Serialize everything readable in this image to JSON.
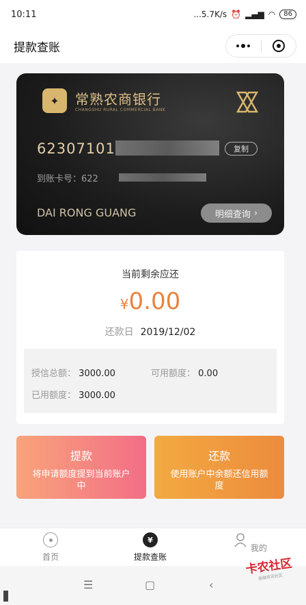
{
  "status_bar": {
    "time": "10:11",
    "net_speed": "...5.7K/s",
    "battery": "86"
  },
  "nav": {
    "title": "提款查账"
  },
  "card": {
    "bank_name": "常熟农商银行",
    "bank_subtitle": "CHANGSHU RURAL COMMERCIAL BANK",
    "card_number_visible": "62307101",
    "copy_label": "复制",
    "receive_label": "到账卡号：622",
    "holder_name": "DAI RONG GUANG",
    "detail_label": "明细查询"
  },
  "balance": {
    "title": "当前剩余应还",
    "currency": "¥",
    "amount": "0.00",
    "due_label": "还款日",
    "due_date": "2019/12/02",
    "total_credit_label": "授信总额：",
    "total_credit_value": "3000.00",
    "available_label": "可用额度：",
    "available_value": "0.00",
    "used_label": "已用额度：",
    "used_value": "3000.00"
  },
  "actions": {
    "withdraw_title": "提款",
    "withdraw_desc": "将申请额度提到当前账户中",
    "repay_title": "还款",
    "repay_desc": "使用账户中余额还信用额度"
  },
  "tabs": [
    {
      "label": "首页"
    },
    {
      "label": "提款查账"
    },
    {
      "label": "我的"
    }
  ],
  "watermark": {
    "text": "卡农社区",
    "sub": "金融资讯社区"
  },
  "colors": {
    "accent_orange": "#e9823f",
    "withdraw_gradient": "#f26e86",
    "repay_gradient": "#ec8b3e"
  }
}
